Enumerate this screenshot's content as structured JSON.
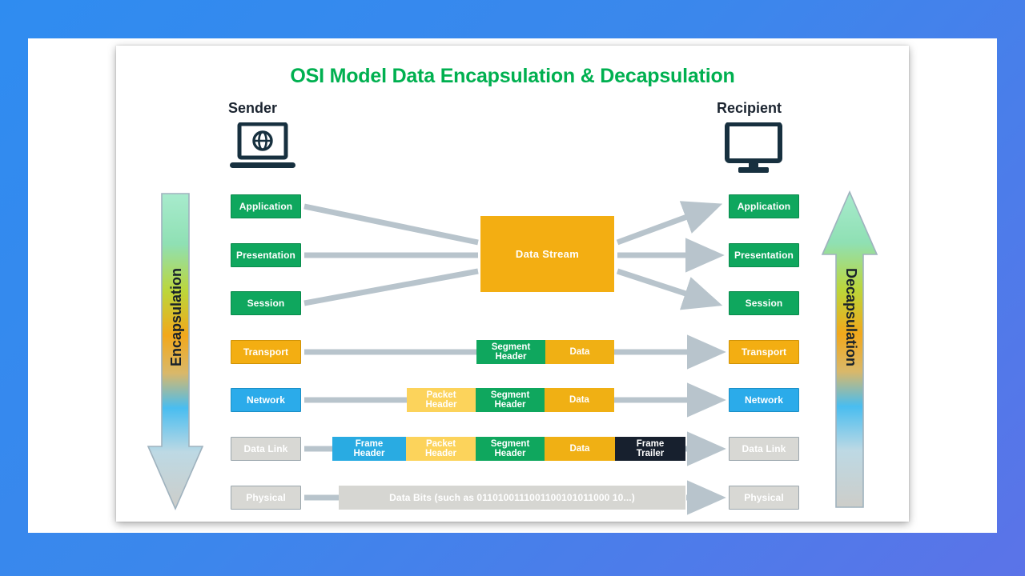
{
  "diagram": {
    "title": "OSI Model Data Encapsulation & Decapsulation",
    "title_color": "#00B050"
  },
  "endpoints": {
    "sender": {
      "label": "Sender",
      "icon": "laptop-globe-icon"
    },
    "recipient": {
      "label": "Recipient",
      "icon": "desktop-monitor-icon"
    }
  },
  "flow_arrows": {
    "left": {
      "label": "Encapsulation",
      "direction": "down"
    },
    "right": {
      "label": "Decapsulation",
      "direction": "up"
    }
  },
  "layers": [
    {
      "name": "Application",
      "color": "#0FA75E",
      "style": "green"
    },
    {
      "name": "Presentation",
      "color": "#0FA75E",
      "style": "green"
    },
    {
      "name": "Session",
      "color": "#0FA75E",
      "style": "green"
    },
    {
      "name": "Transport",
      "color": "#F3AE12",
      "style": "amber"
    },
    {
      "name": "Network",
      "color": "#2BABEA",
      "style": "blue"
    },
    {
      "name": "Data Link",
      "color": "#D8D8D4",
      "style": "gray"
    },
    {
      "name": "Physical",
      "color": "#D8D8D4",
      "style": "gray"
    }
  ],
  "pdu": {
    "data_stream": "Data Stream",
    "segment_header": "Segment\nHeader",
    "segment_header_l1": "Segment",
    "segment_header_l2": "Header",
    "packet_header_l1": "Packet",
    "packet_header_l2": "Header",
    "frame_header_l1": "Frame",
    "frame_header_l2": "Header",
    "frame_trailer_l1": "Frame",
    "frame_trailer_l2": "Trailer",
    "data": "Data",
    "data_bits": "Data Bits (such as 0110100111001100101011000 10...)"
  },
  "palette": {
    "background_blue": "#2f8cf0",
    "green": "#0FA75E",
    "amber": "#F3AE12",
    "light_yellow": "#FCD35B",
    "sky_blue": "#29ABE2",
    "gray": "#D6D6D2",
    "navy": "#17202E",
    "connector": "#B8C4CC"
  }
}
